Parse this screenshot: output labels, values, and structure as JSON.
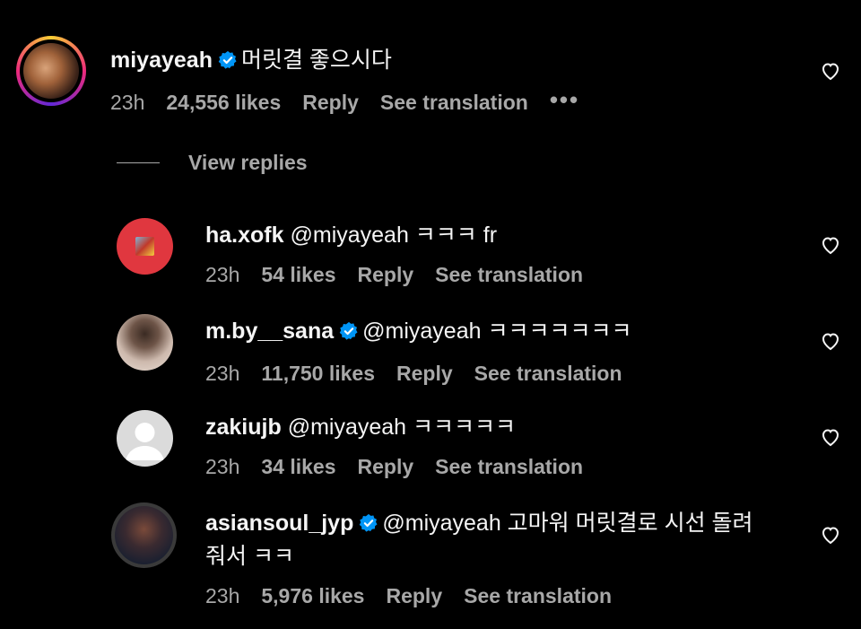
{
  "comments": [
    {
      "username": "miyayeah",
      "verified": true,
      "text": "머릿결 좋으시다",
      "time": "23h",
      "likes": "24,556 likes",
      "reply": "Reply",
      "translate": "See translation",
      "more": "•••"
    },
    {
      "username": "ha.xofk",
      "verified": false,
      "text": "@miyayeah ㅋㅋㅋ fr",
      "time": "23h",
      "likes": "54 likes",
      "reply": "Reply",
      "translate": "See translation"
    },
    {
      "username": "m.by__sana",
      "verified": true,
      "text": "@miyayeah ㅋㅋㅋㅋㅋㅋㅋ",
      "time": "23h",
      "likes": "11,750 likes",
      "reply": "Reply",
      "translate": "See translation"
    },
    {
      "username": "zakiujb",
      "verified": false,
      "text": "@miyayeah ㅋㅋㅋㅋㅋ",
      "time": "23h",
      "likes": "34 likes",
      "reply": "Reply",
      "translate": "See translation"
    },
    {
      "username": "asiansoul_jyp",
      "verified": true,
      "text": "@miyayeah 고마워 머릿결로 시선 돌려 줘서 ㅋㅋ",
      "time": "23h",
      "likes": "5,976 likes",
      "reply": "Reply",
      "translate": "See translation"
    }
  ],
  "view_replies": "View replies",
  "colors": {
    "background": "#000000",
    "text": "#f5f5f5",
    "muted": "#a8a8a8",
    "verified": "#0095f6"
  },
  "icons": [
    "verified-badge-icon",
    "heart-icon",
    "more-options-icon",
    "default-avatar-icon"
  ]
}
